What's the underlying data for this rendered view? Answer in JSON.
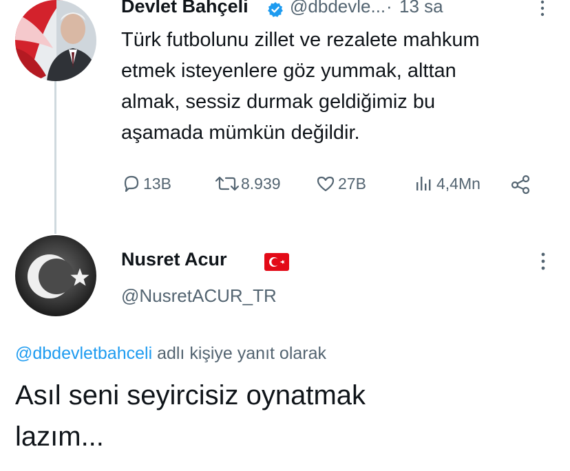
{
  "tweet1": {
    "author_name": "Devlet Bahçeli",
    "verified_icon": "verified-badge-icon",
    "handle": "@dbdevle...",
    "separator": "·",
    "time": "13 sa",
    "text_lines": [
      "Türk futbolunu zillet ve rezalete mahkum",
      "etmek isteyenlere göz yummak, alttan",
      "almak, sessiz durmak geldiğimiz bu",
      "aşamada mümkün değildir."
    ],
    "actions": {
      "replies": "13B",
      "retweets": "8.939",
      "likes": "27B",
      "views": "4,4Mn"
    },
    "colors": {
      "verified": "#1d9bf0",
      "muted": "#536471"
    }
  },
  "tweet2": {
    "author_name": "Nusret Acur",
    "flag_icon": "turkey-flag-icon",
    "handle": "@NusretACUR_TR",
    "reply_to_mention": "@dbdevletbahceli",
    "reply_to_suffix": " adlı kişiye yanıt olarak",
    "text_lines": [
      "Asıl seni seyircisiz oynatmak",
      "lazım..."
    ],
    "colors": {
      "mention": "#1d9bf0",
      "flag": "#e30a17"
    }
  }
}
